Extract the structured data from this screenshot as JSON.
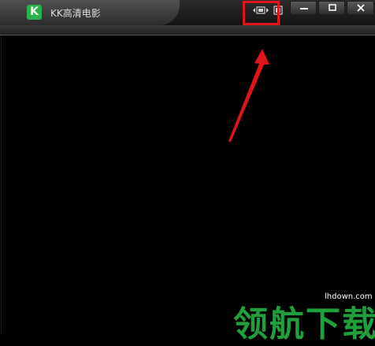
{
  "app": {
    "logo_letter": "K",
    "title": "KK高清电影"
  },
  "window_controls": {
    "minimize_icon": "minimize-icon",
    "maximize_icon": "maximize-icon",
    "close_icon": "close-icon"
  },
  "toolbar": {
    "aspect_icon": "aspect-ratio-icon",
    "fullscreen_icon": "fullscreen-icon"
  },
  "annotation": {
    "color": "#e0141b"
  },
  "watermark": {
    "domain": "lhdown.com",
    "text": "领航下载",
    "color": "#1fa03c"
  }
}
